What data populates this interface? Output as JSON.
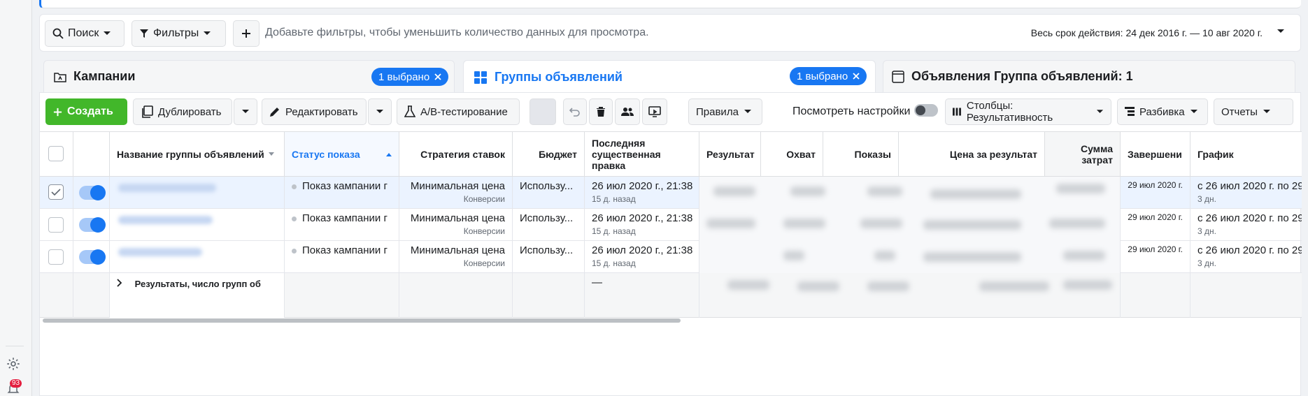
{
  "rail": {
    "notifications_count": "93"
  },
  "filterbar": {
    "search_label": "Поиск",
    "filters_label": "Фильтры",
    "hint": "Добавьте фильтры, чтобы уменьшить количество данных для просмотра.",
    "date_range": "Весь срок действия: 24 дек 2016 г. — 10 авг 2020 г."
  },
  "tabs": {
    "campaigns": {
      "label": "Кампании",
      "selected": "1 выбрано"
    },
    "adsets": {
      "label": "Группы объявлений",
      "selected": "1 выбрано"
    },
    "ads": {
      "label": "Объявления Группа объявлений: 1"
    }
  },
  "toolbar": {
    "create": "Создать",
    "duplicate": "Дублировать",
    "edit": "Редактировать",
    "ab_test": "A/B-тестирование",
    "rules": "Правила",
    "view_settings": "Посмотреть настройки",
    "columns": "Столбцы: Результативность",
    "breakdown": "Разбивка",
    "reports": "Отчеты"
  },
  "table": {
    "headers": {
      "name": "Название группы объявлений",
      "delivery": "Статус показа",
      "bid": "Стратегия ставок",
      "budget": "Бюджет",
      "last_edit": "Последняя существенная правка",
      "results": "Результат",
      "reach": "Охват",
      "impressions": "Показы",
      "cost_per_result": "Цена за результат",
      "amount_spent": "Сумма затрат",
      "ends": "Завершени",
      "schedule": "График"
    },
    "rows": [
      {
        "delivery": "Показ кампании г",
        "bid": "Минимальная цена",
        "bid_sub": "Конверсии",
        "budget": "Использу...",
        "edit": "26 июл 2020 г., 21:38",
        "edit_sub": "15 д. назад",
        "ends": "29 июл 2020 г.",
        "schedule": "с 26 июл 2020 г. по 29",
        "schedule_sub": "3 дн."
      },
      {
        "delivery": "Показ кампании г",
        "bid": "Минимальная цена",
        "bid_sub": "Конверсии",
        "budget": "Использу...",
        "edit": "26 июл 2020 г., 21:38",
        "edit_sub": "15 д. назад",
        "ends": "29 июл 2020 г.",
        "schedule": "с 26 июл 2020 г. по 29",
        "schedule_sub": "3 дн."
      },
      {
        "delivery": "Показ кампании г",
        "bid": "Минимальная цена",
        "bid_sub": "Конверсии",
        "budget": "Использу...",
        "edit": "26 июл 2020 г., 21:38",
        "edit_sub": "15 д. назад",
        "ends": "29 июл 2020 г.",
        "schedule": "с 26 июл 2020 г. по 29",
        "schedule_sub": "3 дн."
      }
    ],
    "summary": {
      "label": "Результаты, число групп об",
      "edit": "—"
    }
  }
}
